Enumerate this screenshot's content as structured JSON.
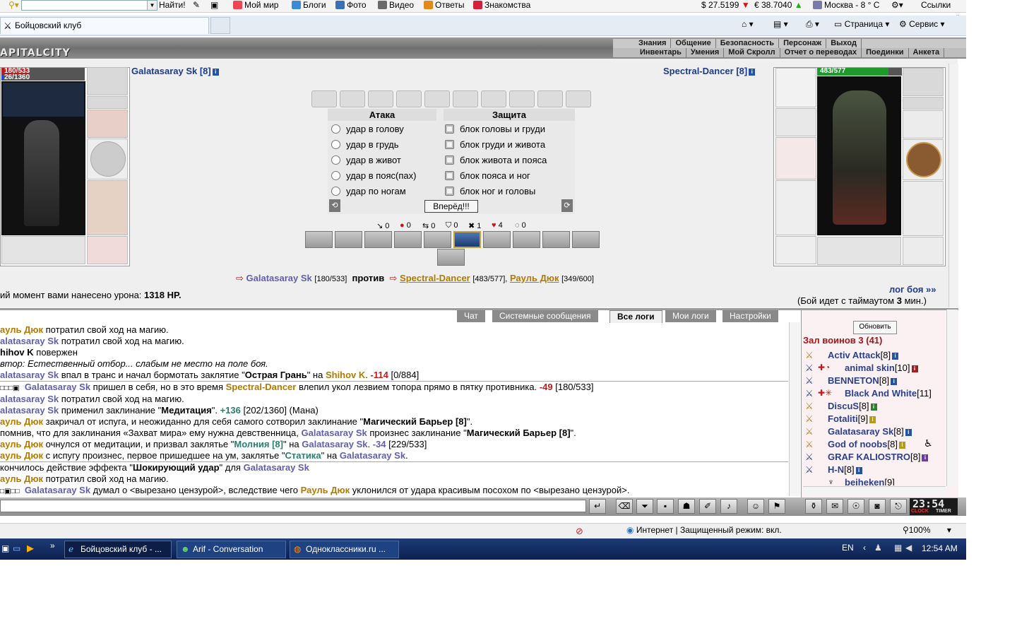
{
  "toolbar": {
    "find_label": "Найти!",
    "links": [
      "Мой мир",
      "Блоги",
      "Фото",
      "Видео",
      "Ответы",
      "Знакомства"
    ],
    "usd": "$ 27.5199",
    "eur": "€ 38.7040",
    "weather": "Москва - 8 ° C",
    "links_label": "Ссылки"
  },
  "tab": {
    "title": "Бойцовский клуб"
  },
  "commands": {
    "page": "Страница",
    "service": "Сервис"
  },
  "game": {
    "logo": "APITALCITY",
    "menu1": [
      "Знания",
      "Общение",
      "Безопасность",
      "Персонаж",
      "Выход"
    ],
    "menu2": [
      "Инвентарь",
      "Умения",
      "Мой Скролл",
      "Отчет о переводах",
      "Поединки",
      "Анкета"
    ],
    "left_player": {
      "name": "Galatasaray Sk [8]",
      "hp": "180/533",
      "mana": "26/1360"
    },
    "right_player": {
      "name": "Spectral-Dancer [8]",
      "hp": "483/577"
    },
    "attack_header": "Атака",
    "defense_header": "Защита",
    "attacks": [
      "удар в голову",
      "удар в грудь",
      "удар в живот",
      "удар в пояс(пах)",
      "удар по ногам"
    ],
    "blocks": [
      "блок головы и груди",
      "блок груди и живота",
      "блок живота и пояса",
      "блок пояса и ног",
      "блок ног и головы"
    ],
    "forward_button": "Вперёд!!!",
    "stats": [
      "0",
      "0",
      "0",
      "0",
      "1",
      "4",
      "0"
    ],
    "versus": {
      "left_name": "Galatasaray Sk",
      "left_hp": "[180/533]",
      "vs": "против",
      "right_name1": "Spectral-Dancer",
      "right_hp1": "[483/577],",
      "right_name2": "Рауль Дюк",
      "right_hp2": "[349/600]"
    },
    "damage_text": "ий момент вами нанесено урона:",
    "damage_value": "1318 HP.",
    "log_link": "лог боя »»",
    "timeout_text": "(Бой идет с таймаутом",
    "timeout_value": "3",
    "timeout_unit": "мин.)"
  },
  "chat_tabs": [
    "Чат",
    "Системные сообщения",
    "Все логи",
    "Мои логи",
    "Настройки"
  ],
  "chat": {
    "l1a": "ауль Дюк",
    "l1b": " потратил свой ход на магию.",
    "l2a": "alatasaray Sk",
    "l2b": " потратил свой ход на магию.",
    "l3a": "hihov K",
    "l3b": " повержен",
    "l4": "втор: Естественный отбор... слабым не место на поле боя.",
    "l5a": "alatasaray Sk",
    "l5b": " впал в транс и начал бормотать заклятие \"",
    "l5c": "Острая Грань",
    "l5d": "\" на ",
    "l5e": "Shihov K",
    "l5f": ". ",
    "l5g": "-114",
    "l5h": " [0/884]",
    "l6a": "Galatasaray Sk",
    "l6b": " пришел в себя, но в это время ",
    "l6c": "Spectral-Dancer",
    "l6d": " влепил укол лезвием топора прямо в пятку противника. ",
    "l6e": "-49",
    "l6f": " [180/533]",
    "l7a": "alatasaray Sk",
    "l7b": " потратил свой ход на магию.",
    "l8a": "alatasaray Sk",
    "l8b": " применил заклинание \"",
    "l8c": "Медитация",
    "l8d": "\". ",
    "l8e": "+136",
    "l8f": " [202/1360] (Мана)",
    "l9a": "ауль Дюк",
    "l9b": " закричал от испуга, и неожиданно для себя самого сотворил заклинание \"",
    "l9c": "Магический Барьер [8]",
    "l9d": "\".",
    "l10a": "помнив, что для заклинания «Захват мира» ему нужна девственница, ",
    "l10b": "Galatasaray Sk",
    "l10c": " произнес заклинание \"",
    "l10d": "Магический Барьер [8]",
    "l10e": "\".",
    "l11a": "ауль Дюк",
    "l11b": " очнулся от медитации, и призвал заклятье \"",
    "l11c": "Молния [8]",
    "l11d": "\" на ",
    "l11e": "Galatasaray Sk",
    "l11f": ". ",
    "l11g": "-34",
    "l11h": " [229/533]",
    "l12a": "ауль Дюк",
    "l12b": " с испугу произнес, первое пришедшее на ум, заклятье \"",
    "l12c": "Статика",
    "l12d": "\" на ",
    "l12e": "Galatasaray Sk",
    "l12f": ".",
    "l13a": "кончилось действие эффекта \"",
    "l13b": "Шокирующий удар",
    "l13c": "\" для ",
    "l13d": "Galatasaray Sk",
    "l14a": "ауль Дюк",
    "l14b": " потратил свой ход на магию.",
    "l15a": "Galatasaray Sk",
    "l15b": " думал о <вырезано цензурой>, вследствие чего ",
    "l15c": "Рауль Дюк",
    "l15d": " уклонился от удара красивым посохом по <вырезано цензурой>."
  },
  "online": {
    "refresh": "Обновить",
    "room": "Зал воинов 3 (41)",
    "players": [
      {
        "name": "Activ Attack",
        "lvl": "[8]"
      },
      {
        "name": "animal skin",
        "lvl": "[10]"
      },
      {
        "name": "BENNETON",
        "lvl": "[8]"
      },
      {
        "name": "Black And White",
        "lvl": "[11]"
      },
      {
        "name": "DiscuS",
        "lvl": "[8]"
      },
      {
        "name": "Fotaliti",
        "lvl": "[9]"
      },
      {
        "name": "Galatasaray Sk",
        "lvl": "[8]"
      },
      {
        "name": "God of noobs",
        "lvl": "[8]"
      },
      {
        "name": "GRAF KALIOSTRO",
        "lvl": "[8]"
      },
      {
        "name": "H-N",
        "lvl": "[8]"
      },
      {
        "name": "beiheken",
        "lvl": "[9]"
      }
    ]
  },
  "clock": {
    "time": "23:54",
    "clock_label": "CLOCK",
    "timer_label": "TIMER"
  },
  "statusbar": {
    "zone": "Интернет | Защищенный режим: вкл.",
    "zoom": "100%"
  },
  "taskbar": {
    "tasks": [
      "Бойцовский клуб - ...",
      "Arif - Conversation",
      "Одноклассники.ru ..."
    ],
    "lang": "EN",
    "time": "12:54 AM"
  }
}
